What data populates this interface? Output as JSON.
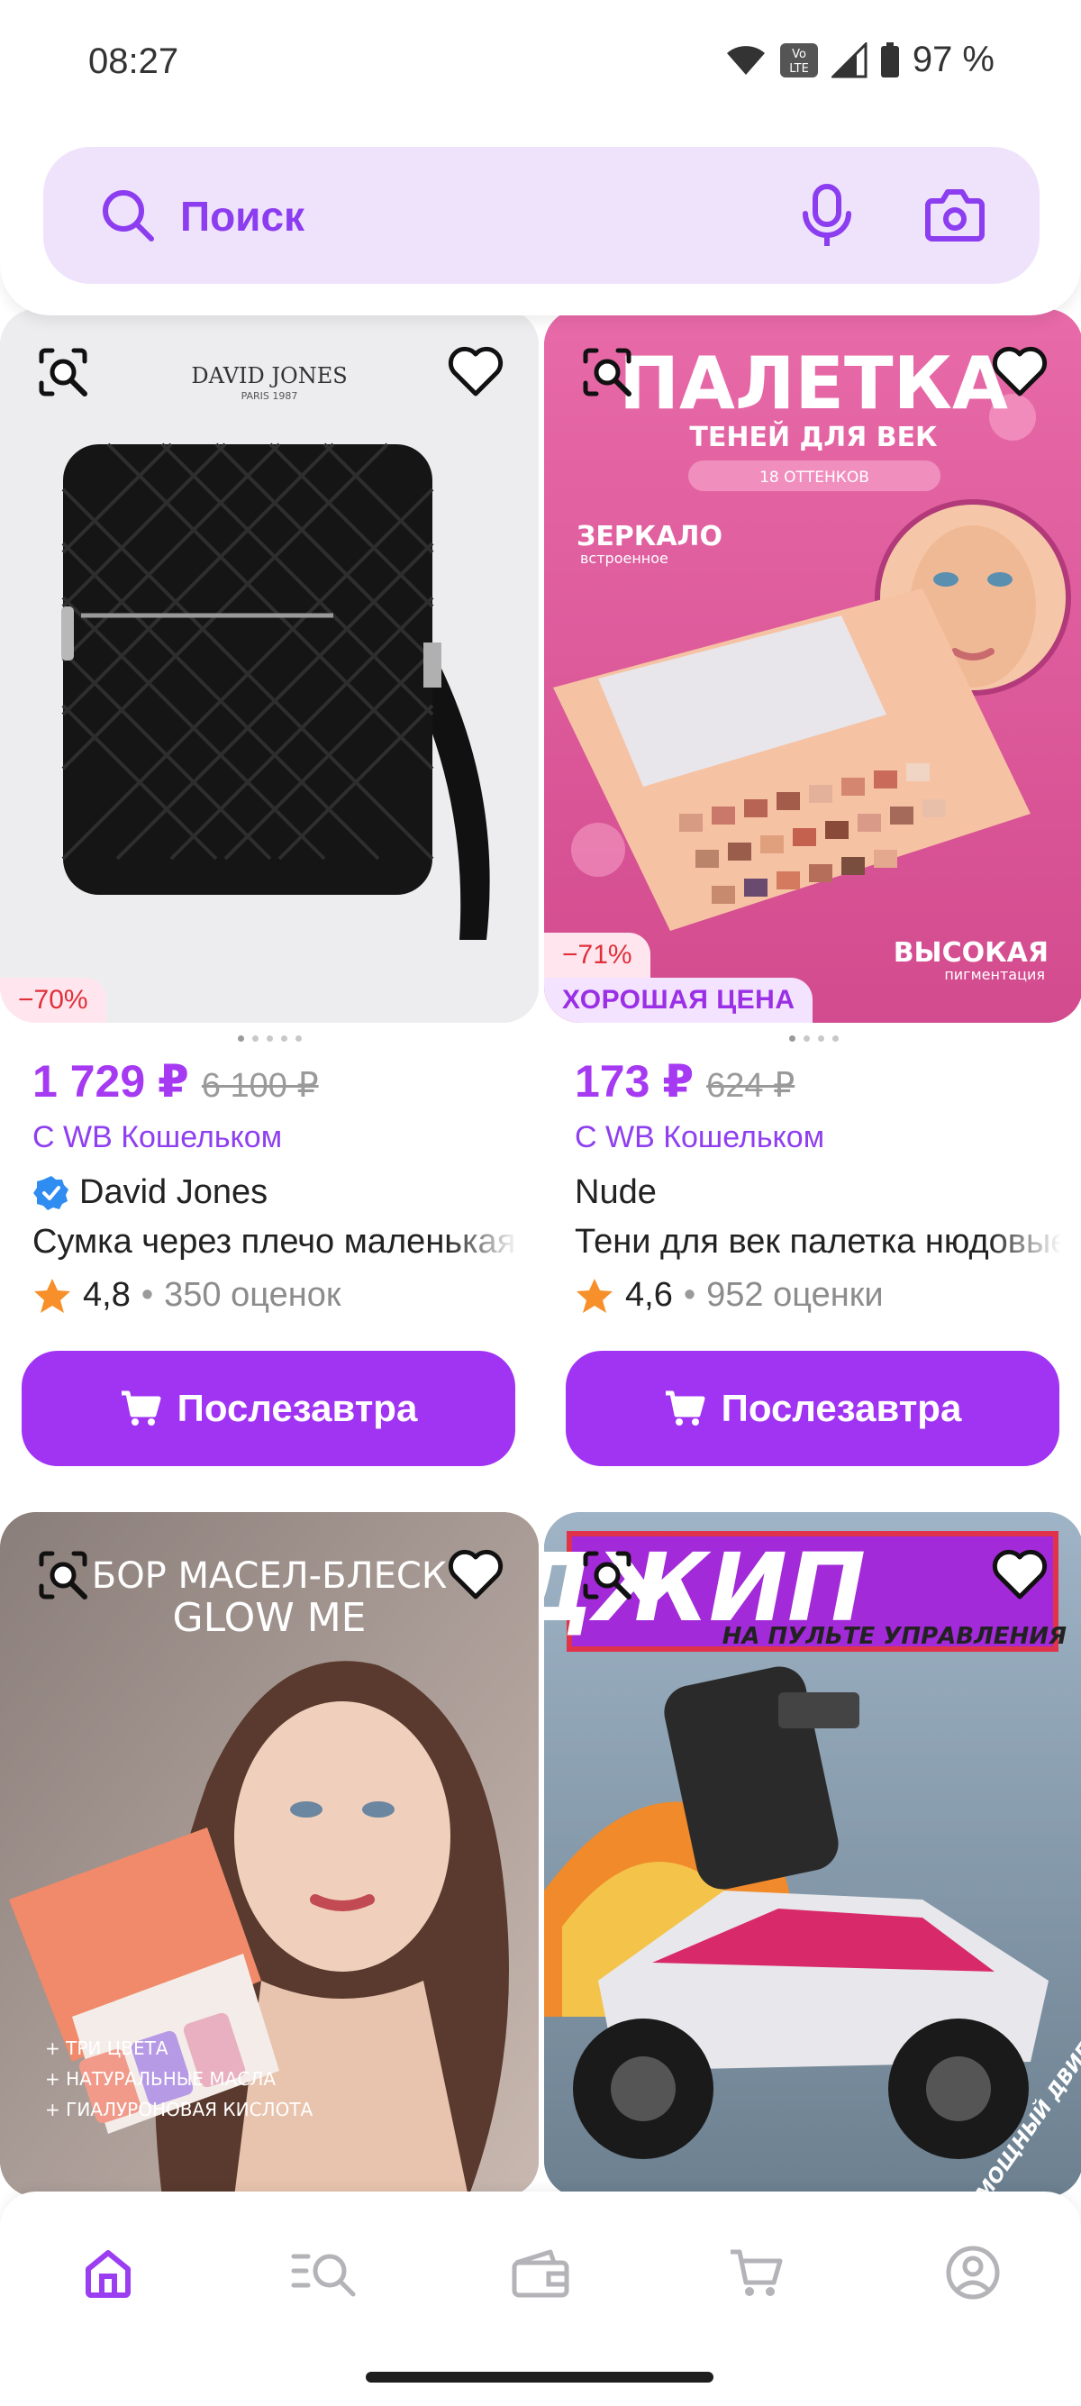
{
  "status_bar": {
    "time": "08:27",
    "battery": "97 %"
  },
  "search": {
    "placeholder": "Поиск"
  },
  "products": [
    {
      "price": "1 729 ₽",
      "old_price": "6 100 ₽",
      "wallet_note": "С WB Кошельком",
      "brand": "David Jones",
      "brand_verified": true,
      "title": "Сумка через плечо маленькая",
      "rating": "4,8",
      "reviews": "350 оценок",
      "discount": "−70%",
      "badge": "",
      "image_text": [
        "DAVID JONES",
        "PARIS 1987"
      ],
      "button_label": "Послезавтра"
    },
    {
      "price": "173 ₽",
      "old_price": "624 ₽",
      "wallet_note": "С WB Кошельком",
      "brand": "Nude",
      "brand_verified": false,
      "title": "Тени для век палетка нюдовые",
      "rating": "4,6",
      "reviews": "952 оценки",
      "discount": "−71%",
      "badge": "ХОРОШАЯ ЦЕНА",
      "image_text": [
        "ПАЛЕТКА",
        "ТЕНЕЙ ДЛЯ ВЕК",
        "18 ОТТЕНКОВ",
        "ЗЕРКАЛО",
        "встроенное",
        "ВЫСОКАЯ",
        "пигментация"
      ],
      "button_label": "Послезавтра"
    },
    {
      "image_text": [
        "БОР МАСЕЛ-БЛЕСК",
        "GLOW ME",
        "+ ТРИ ЦВЕТА",
        "+ НАТУРАЛЬНЫЕ МАСЛА",
        "+ ГИАЛУРОНОВАЯ КИСЛОТА"
      ]
    },
    {
      "image_text": [
        "ДЖИП",
        "НА ПУЛЬТЕ УПРАВЛЕНИЯ",
        "МОЩНЫЙ ДВИГАТЕЛЬ"
      ]
    }
  ],
  "nav": [
    "home-icon",
    "catalog-search-icon",
    "wallet-icon",
    "cart-icon",
    "profile-icon"
  ],
  "colors": {
    "accent": "#a133f3",
    "price": "#a53af2",
    "search_bg": "#efe3fc",
    "discount": "#e0303a"
  }
}
